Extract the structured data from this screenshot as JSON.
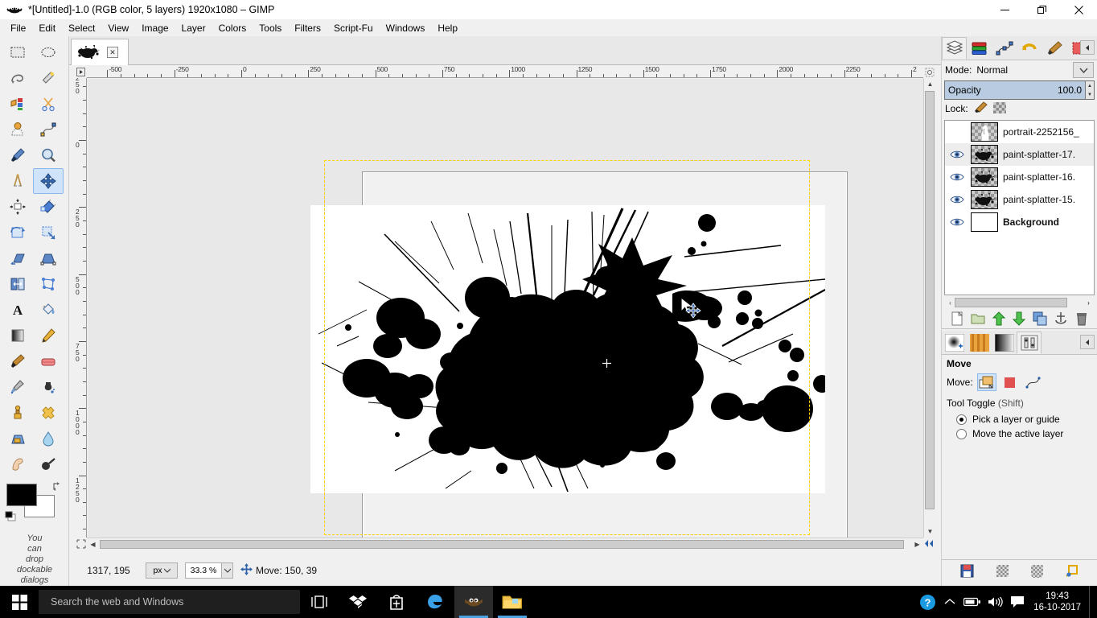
{
  "window": {
    "title": "*[Untitled]-1.0 (RGB color, 5 layers) 1920x1080 – GIMP",
    "minimize": "–",
    "maximize": "❐",
    "close": "✕"
  },
  "menubar": {
    "items": [
      {
        "label": "File"
      },
      {
        "label": "Edit"
      },
      {
        "label": "Select"
      },
      {
        "label": "View"
      },
      {
        "label": "Image"
      },
      {
        "label": "Layer"
      },
      {
        "label": "Colors"
      },
      {
        "label": "Tools"
      },
      {
        "label": "Filters"
      },
      {
        "label": "Script-Fu"
      },
      {
        "label": "Windows"
      },
      {
        "label": "Help"
      }
    ]
  },
  "toolbox": {
    "tools": [
      {
        "name": "rect-select-icon"
      },
      {
        "name": "ellipse-select-icon"
      },
      {
        "name": "free-select-icon"
      },
      {
        "name": "fuzzy-select-icon"
      },
      {
        "name": "select-by-color-icon"
      },
      {
        "name": "scissors-select-icon"
      },
      {
        "name": "foreground-select-icon"
      },
      {
        "name": "paths-icon"
      },
      {
        "name": "color-picker-icon"
      },
      {
        "name": "zoom-icon"
      },
      {
        "name": "measure-icon"
      },
      {
        "name": "move-icon"
      },
      {
        "name": "alignment-icon"
      },
      {
        "name": "crop-icon"
      },
      {
        "name": "rotate-icon"
      },
      {
        "name": "scale-icon"
      },
      {
        "name": "shear-icon"
      },
      {
        "name": "perspective-icon"
      },
      {
        "name": "flip-icon"
      },
      {
        "name": "cage-transform-icon"
      },
      {
        "name": "text-icon"
      },
      {
        "name": "bucket-fill-icon"
      },
      {
        "name": "gradient-icon"
      },
      {
        "name": "pencil-icon"
      },
      {
        "name": "paintbrush-icon"
      },
      {
        "name": "eraser-icon"
      },
      {
        "name": "airbrush-icon"
      },
      {
        "name": "ink-icon"
      },
      {
        "name": "clone-icon"
      },
      {
        "name": "heal-icon"
      },
      {
        "name": "perspective-clone-icon"
      },
      {
        "name": "blur-sharpen-icon"
      },
      {
        "name": "smudge-icon"
      },
      {
        "name": "dodge-burn-icon"
      }
    ],
    "active_tool": "move-icon",
    "foreground_color": "#000000",
    "background_color": "#ffffff",
    "drop_hint": [
      "You",
      "can",
      "drop",
      "dockable",
      "dialogs"
    ]
  },
  "image_window": {
    "tab": {
      "name": "image-tab",
      "close_label": "✕"
    },
    "ruler_h_labels": [
      "-500",
      "-250",
      "0",
      "250",
      "500",
      "750",
      "1000",
      "1250",
      "1500",
      "1750",
      "2000",
      "2250",
      "2"
    ],
    "ruler_v_labels": [
      "250",
      "0",
      "250",
      "500",
      "750",
      "1000",
      "1250"
    ],
    "canvas_bg": "#e8e8e8",
    "image_bg": "#ffffff"
  },
  "statusbar": {
    "position": "1317, 195",
    "unit": "px",
    "zoom": "33.3 %",
    "message": "Move: 150, 39"
  },
  "dock": {
    "tabs": [
      {
        "name": "layers-tab"
      },
      {
        "name": "channels-tab"
      },
      {
        "name": "paths-tab"
      },
      {
        "name": "undo-history-tab"
      },
      {
        "name": "brushes-tab"
      },
      {
        "name": "patterns-tab"
      }
    ],
    "mode_label": "Mode:",
    "mode_value": "Normal",
    "opacity_label": "Opacity",
    "opacity_value": "100.0",
    "lock_label": "Lock:",
    "layers": [
      {
        "name": "portrait-2252156_",
        "visible": false,
        "thumb": "portrait",
        "bold": false,
        "active": true
      },
      {
        "name": "paint-splatter-17.",
        "visible": true,
        "thumb": "splatter",
        "bold": false,
        "active": false
      },
      {
        "name": "paint-splatter-16.",
        "visible": true,
        "thumb": "splatter",
        "bold": false,
        "active": false
      },
      {
        "name": "paint-splatter-15.",
        "visible": true,
        "thumb": "splatter",
        "bold": false,
        "active": false
      },
      {
        "name": "Background",
        "visible": true,
        "thumb": "white",
        "bold": true,
        "active": false
      }
    ],
    "layer_buttons": [
      {
        "name": "new-layer-button"
      },
      {
        "name": "new-layer-group-button"
      },
      {
        "name": "raise-layer-button"
      },
      {
        "name": "lower-layer-button"
      },
      {
        "name": "duplicate-layer-button"
      },
      {
        "name": "anchor-layer-button"
      },
      {
        "name": "delete-layer-button"
      }
    ],
    "dock2_tabs": [
      {
        "name": "brushes-tab"
      },
      {
        "name": "patterns-tab"
      },
      {
        "name": "gradients-tab"
      },
      {
        "name": "tool-options-tab"
      }
    ],
    "tool_options": {
      "title": "Move",
      "move_label": "Move:",
      "move_modes": [
        {
          "name": "move-layer-mode",
          "selected": true
        },
        {
          "name": "move-selection-mode",
          "selected": false
        },
        {
          "name": "move-path-mode",
          "selected": false
        }
      ],
      "tool_toggle_label": "Tool Toggle",
      "tool_toggle_shortcut": "(Shift)",
      "options": [
        {
          "label": "Pick a layer or guide",
          "selected": true
        },
        {
          "label": "Move the active layer",
          "selected": false
        }
      ]
    },
    "bottom_buttons": [
      {
        "name": "save-tool-options-button"
      },
      {
        "name": "restore-tool-options-button"
      },
      {
        "name": "delete-tool-options-button"
      },
      {
        "name": "reset-tool-options-button"
      }
    ]
  },
  "taskbar": {
    "search_placeholder": "Search the web and Windows",
    "icons": [
      {
        "name": "task-view-icon"
      },
      {
        "name": "dropbox-icon"
      },
      {
        "name": "store-icon"
      },
      {
        "name": "edge-icon"
      },
      {
        "name": "gimp-icon"
      },
      {
        "name": "file-explorer-icon"
      }
    ],
    "tray": [
      {
        "name": "help-icon"
      },
      {
        "name": "show-hidden-icons-icon"
      },
      {
        "name": "battery-icon"
      },
      {
        "name": "volume-icon"
      },
      {
        "name": "action-center-icon"
      }
    ],
    "time": "19:43",
    "date": "16-10-2017"
  }
}
